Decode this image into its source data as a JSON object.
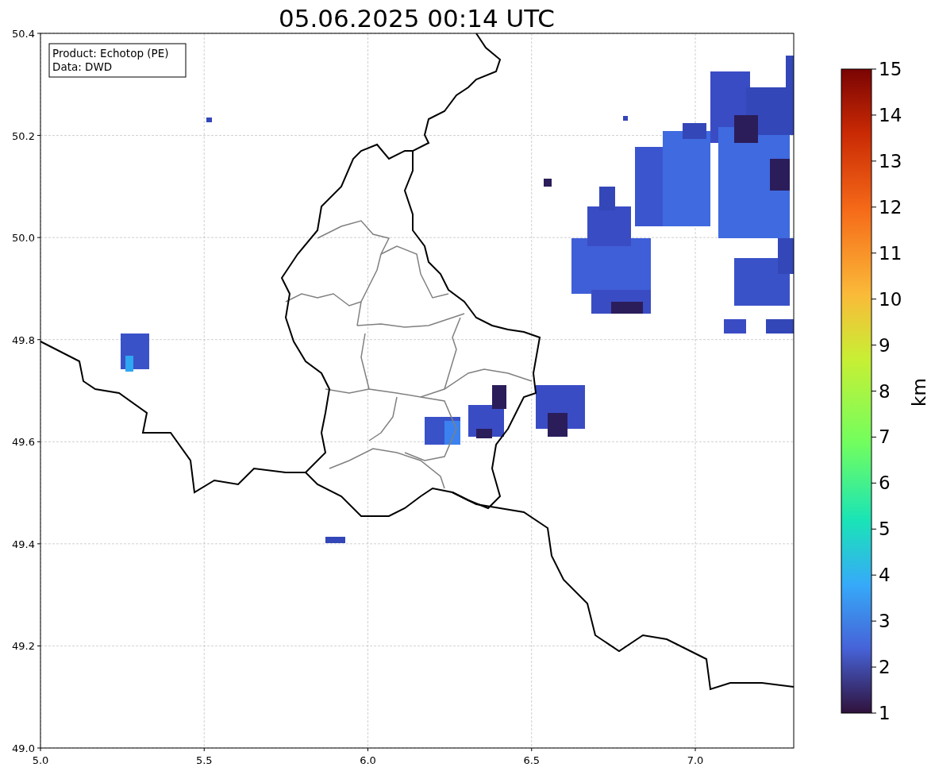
{
  "title": "05.06.2025 00:14 UTC",
  "info_box": [
    "Product: Echotop (PE)",
    "Data: DWD"
  ],
  "map": {
    "xticks": [
      "5.0",
      "5.5",
      "6.0",
      "6.5",
      "7.0"
    ],
    "yticks": [
      "50.4",
      "50.2",
      "50.0",
      "49.8",
      "49.6",
      "49.4",
      "49.2",
      "49.0"
    ]
  },
  "colorbar": {
    "label": "km",
    "ticks": [
      "15",
      "14",
      "13",
      "12",
      "11",
      "10",
      "9",
      "8",
      "7",
      "6",
      "5",
      "4",
      "3",
      "2",
      "1"
    ]
  }
}
